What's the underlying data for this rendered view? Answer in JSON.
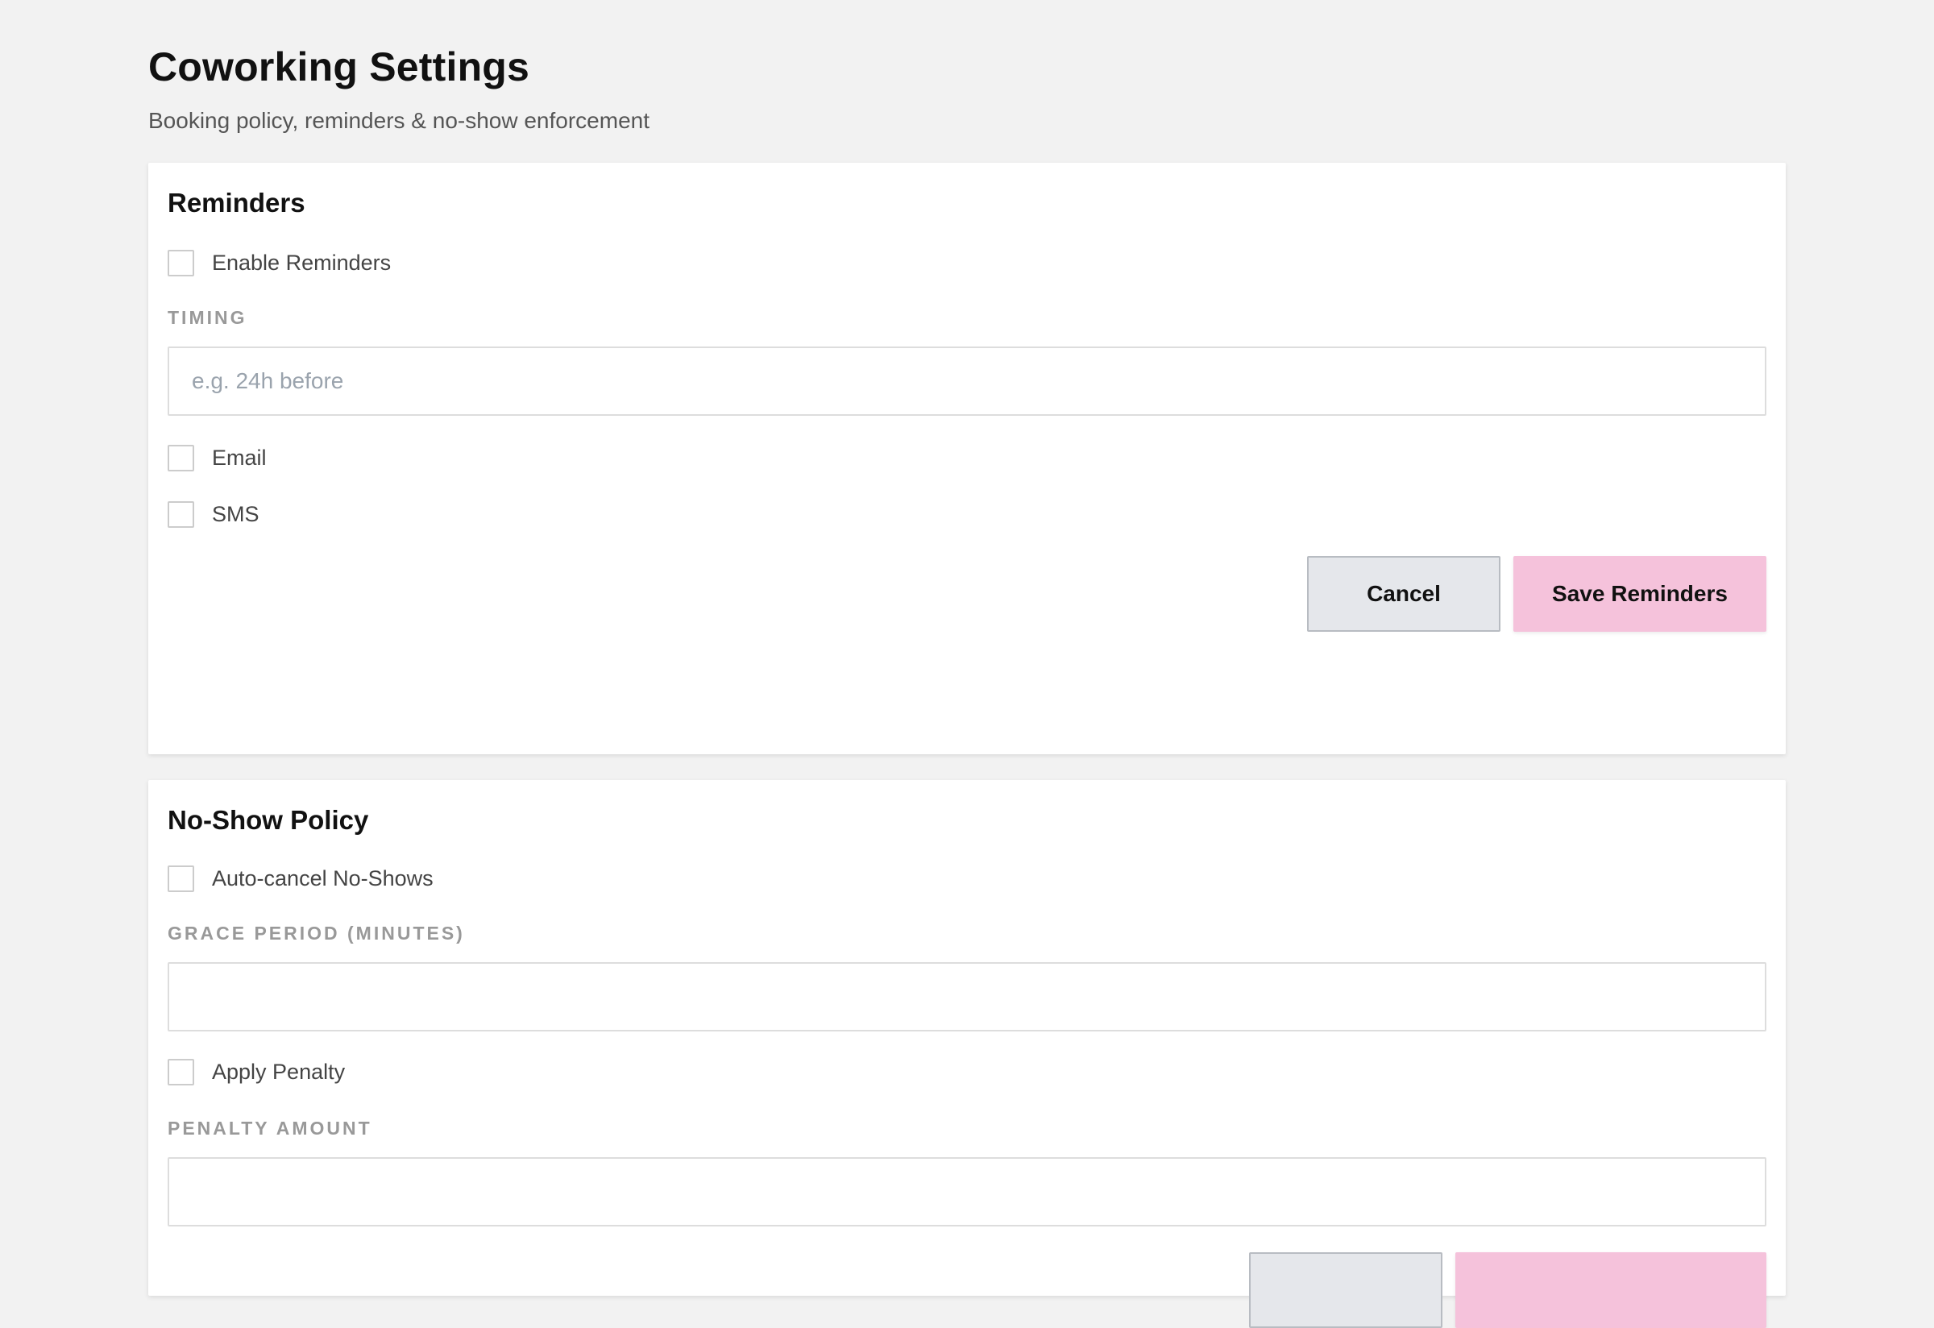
{
  "header": {
    "title": "Coworking Settings",
    "subtitle": "Booking policy, reminders & no-show enforcement"
  },
  "reminders": {
    "title": "Reminders",
    "enable_label": "Enable Reminders",
    "enable_checked": false,
    "timing_label": "TIMING",
    "timing_value": "",
    "timing_placeholder": "e.g. 24h before",
    "email_label": "Email",
    "email_checked": false,
    "sms_label": "SMS",
    "sms_checked": false,
    "cancel_label": "Cancel",
    "save_label": "Save Reminders"
  },
  "no_show": {
    "title": "No-Show Policy",
    "auto_cancel_label": "Auto-cancel No-Shows",
    "auto_cancel_checked": false,
    "grace_label": "GRACE PERIOD (MINUTES)",
    "grace_value": "",
    "penalty_label": "Apply Penalty",
    "penalty_checked": false,
    "penalty_amount_label": "PENALTY AMOUNT",
    "penalty_amount_value": ""
  },
  "colors": {
    "background": "#f2f2f2",
    "card": "#ffffff",
    "cancel_button": "#e5e7eb",
    "save_button": "#f5c2db",
    "field_label": "#999999"
  }
}
